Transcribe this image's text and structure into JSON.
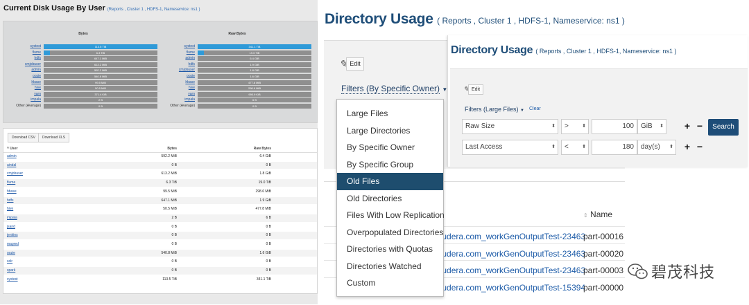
{
  "left_panel": {
    "title": "Current Disk Usage By User",
    "subtitle": "(Reports , Cluster 1 , HDFS-1, Nameservice: ns1 )",
    "bytes_chart": {
      "heading": "Bytes",
      "rows": [
        {
          "label": "systest",
          "value": "113.5 TiB",
          "fraction": 1.0,
          "link": true
        },
        {
          "label": "flume",
          "value": "6.3 TiB",
          "fraction": 0.056,
          "link": true
        },
        {
          "label": "hdfs",
          "value": "647.1 MiB",
          "fraction": 0.0,
          "link": true
        },
        {
          "label": "cmjobuser",
          "value": "613.2 MiB",
          "fraction": 0.0,
          "link": true
        },
        {
          "label": "admin",
          "value": "592.2 MiB",
          "fraction": 0.0,
          "link": true
        },
        {
          "label": "oozie",
          "value": "540.8 MiB",
          "fraction": 0.0,
          "link": true
        },
        {
          "label": "hbase",
          "value": "99.5 MiB",
          "fraction": 0.0,
          "link": true
        },
        {
          "label": "hive",
          "value": "50.5 MiB",
          "fraction": 0.0,
          "link": true
        },
        {
          "label": "yarn",
          "value": "371.4 KiB",
          "fraction": 0.0,
          "link": true
        },
        {
          "label": "impala",
          "value": "2 B",
          "fraction": 0.0,
          "link": true
        },
        {
          "label": "Other (Average)",
          "value": "0 B",
          "fraction": 0.0,
          "link": false
        }
      ]
    },
    "raw_chart": {
      "heading": "Raw Bytes",
      "rows": [
        {
          "label": "systest",
          "value": "341.1 TiB",
          "fraction": 1.0,
          "link": true
        },
        {
          "label": "flume",
          "value": "19.0 TiB",
          "fraction": 0.056,
          "link": true
        },
        {
          "label": "admin",
          "value": "6.4 GiB",
          "fraction": 0.0,
          "link": true
        },
        {
          "label": "hdfs",
          "value": "1.9 GiB",
          "fraction": 0.0,
          "link": true
        },
        {
          "label": "cmjobuser",
          "value": "1.8 GiB",
          "fraction": 0.0,
          "link": true
        },
        {
          "label": "oozie",
          "value": "1.6 GiB",
          "fraction": 0.0,
          "link": true
        },
        {
          "label": "hbase",
          "value": "477.8 MiB",
          "fraction": 0.0,
          "link": true
        },
        {
          "label": "hive",
          "value": "298.6 MiB",
          "fraction": 0.0,
          "link": true
        },
        {
          "label": "yarn",
          "value": "990.9 KiB",
          "fraction": 0.0,
          "link": true
        },
        {
          "label": "impala",
          "value": "6 B",
          "fraction": 0.0,
          "link": true
        },
        {
          "label": "Other (Average)",
          "value": "0 B",
          "fraction": 0.0,
          "link": false
        }
      ]
    },
    "buttons": {
      "csv": "Download CSV",
      "xls": "Download XLS"
    },
    "table": {
      "headers": [
        "^ User",
        "Bytes",
        "Raw Bytes"
      ],
      "rows": [
        [
          "admin",
          "592.2 MiB",
          "6.4 GiB"
        ],
        [
          "aindal",
          "0 B",
          "0 B"
        ],
        [
          "cmjobuser",
          "613.2 MiB",
          "1.8 GiB"
        ],
        [
          "flume",
          "6.3 TiB",
          "19.0 TiB"
        ],
        [
          "hbase",
          "99.5 MiB",
          "298.6 MiB"
        ],
        [
          "hdfs",
          "647.1 MiB",
          "1.9 GiB"
        ],
        [
          "hive",
          "50.5 MiB",
          "477.8 MiB"
        ],
        [
          "impala",
          "2 B",
          "6 B"
        ],
        [
          "jsand",
          "0 B",
          "0 B"
        ],
        [
          "jenkins",
          "0 B",
          "0 B"
        ],
        [
          "mapred",
          "0 B",
          "0 B"
        ],
        [
          "oozie",
          "540.8 MiB",
          "1.6 GiB"
        ],
        [
          "solr",
          "0 B",
          "0 B"
        ],
        [
          "spark",
          "0 B",
          "0 B"
        ],
        [
          "systest",
          "113.5 TiB",
          "341.1 TiB"
        ]
      ]
    }
  },
  "mid_panel": {
    "title": "Directory Usage",
    "subtitle": "( Reports , Cluster 1 , HDFS-1, Nameservice: ns1 )",
    "edit_label": "Edit",
    "filter_label": "Filters (By Specific Owner)",
    "menu_items": [
      "Large Files",
      "Large Directories",
      "By Specific Owner",
      "By Specific Group",
      "Old Files",
      "Old Directories",
      "Files With Low Replication",
      "Overpopulated Directories",
      "Directories with Quotas",
      "Directories Watched",
      "Custom"
    ],
    "selected_menu_index": 4,
    "col_name": "Name",
    "rows": [
      {
        "path": "loudera.com_workGenOutputTest-23463",
        "name": "part-00016"
      },
      {
        "path": "loudera.com_workGenOutputTest-23463",
        "name": "part-00020"
      },
      {
        "path": "loudera.com_workGenOutputTest-23463",
        "name": "part-00003"
      },
      {
        "path": "loudera.com_workGenOutputTest-15394",
        "name": "part-00000"
      }
    ]
  },
  "right_panel": {
    "title": "Directory Usage",
    "subtitle": "( Reports , Cluster 1 , HDFS-1, Nameservice: ns1 )",
    "edit_label": "Edit",
    "filter_label": "Filters (Large Files)",
    "clear_label": "Clear",
    "filters": [
      {
        "field": "Raw Size",
        "op": ">",
        "value": "100",
        "unit": "GiB"
      },
      {
        "field": "Last Access",
        "op": "<",
        "value": "180",
        "unit": "day(s)"
      }
    ],
    "search_label": "Search"
  },
  "watermark": {
    "text": "碧茂科技"
  },
  "colors": {
    "bar_fill": "#2f9ad8",
    "bar_track": "#8f8f8f",
    "selected_menu": "#1e4d6e",
    "title": "#1e4d78",
    "search_button": "#1e4d78"
  }
}
